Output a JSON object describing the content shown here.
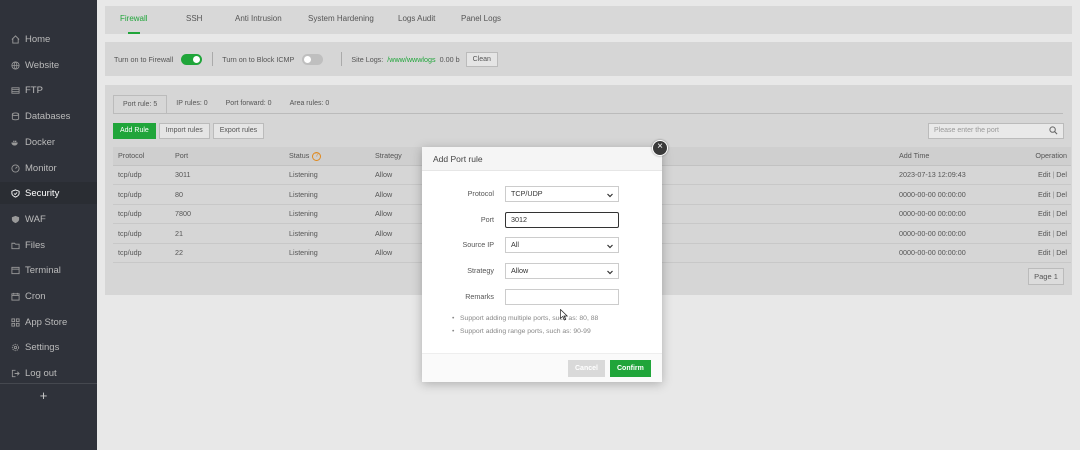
{
  "sidebar": {
    "items": [
      {
        "label": "Home",
        "icon": "home-icon"
      },
      {
        "label": "Website",
        "icon": "globe-icon"
      },
      {
        "label": "FTP",
        "icon": "ftp-icon"
      },
      {
        "label": "Databases",
        "icon": "database-icon"
      },
      {
        "label": "Docker",
        "icon": "docker-icon"
      },
      {
        "label": "Monitor",
        "icon": "monitor-icon"
      },
      {
        "label": "Security",
        "icon": "shield-icon"
      },
      {
        "label": "WAF",
        "icon": "waf-icon"
      },
      {
        "label": "Files",
        "icon": "folder-icon"
      },
      {
        "label": "Terminal",
        "icon": "terminal-icon"
      },
      {
        "label": "Cron",
        "icon": "cron-icon"
      },
      {
        "label": "App Store",
        "icon": "apps-icon"
      },
      {
        "label": "Settings",
        "icon": "gear-icon"
      },
      {
        "label": "Log out",
        "icon": "logout-icon"
      }
    ],
    "add_label": "+"
  },
  "tabs": [
    "Firewall",
    "SSH",
    "Anti Intrusion",
    "System Hardening",
    "Logs Audit",
    "Panel Logs"
  ],
  "toolbar": {
    "firewall_label": "Turn on to Firewall",
    "icmp_label": "Turn on to Block ICMP",
    "site_logs_label": "Site Logs:",
    "site_logs_path": "/www/wwwlogs",
    "site_logs_size": "0.00 b",
    "clean_label": "Clean"
  },
  "subtabs": [
    "Port rule: 5",
    "IP rules: 0",
    "Port forward: 0",
    "Area rules: 0"
  ],
  "actions": {
    "add_rule": "Add Rule",
    "import_rules": "Import rules",
    "export_rules": "Export rules",
    "search_placeholder": "Please enter the port"
  },
  "table": {
    "headers": {
      "protocol": "Protocol",
      "port": "Port",
      "status": "Status",
      "strategy": "Strategy",
      "add_time": "Add Time",
      "operation": "Operation"
    },
    "rows": [
      {
        "protocol": "tcp/udp",
        "port": "3011",
        "status": "Listening",
        "strategy": "Allow",
        "add_time": "2023-07-13 12:09:43",
        "edit": "Edit",
        "sep": "|",
        "del": "Del"
      },
      {
        "protocol": "tcp/udp",
        "port": "80",
        "status": "Listening",
        "strategy": "Allow",
        "add_time": "0000-00-00 00:00:00",
        "edit": "Edit",
        "sep": "|",
        "del": "Del"
      },
      {
        "protocol": "tcp/udp",
        "port": "7800",
        "status": "Listening",
        "strategy": "Allow",
        "add_time": "0000-00-00 00:00:00",
        "edit": "Edit",
        "sep": "|",
        "del": "Del"
      },
      {
        "protocol": "tcp/udp",
        "port": "21",
        "status": "Listening",
        "strategy": "Allow",
        "add_time": "0000-00-00 00:00:00",
        "edit": "Edit",
        "sep": "|",
        "del": "Del"
      },
      {
        "protocol": "tcp/udp",
        "port": "22",
        "status": "Listening",
        "strategy": "Allow",
        "add_time": "0000-00-00 00:00:00",
        "edit": "Edit",
        "sep": "|",
        "del": "Del"
      }
    ],
    "pager": "Page 1"
  },
  "dialog": {
    "title": "Add Port rule",
    "close": "×",
    "protocol_label": "Protocol",
    "protocol_value": "TCP/UDP",
    "port_label": "Port",
    "port_value": "3012",
    "source_ip_label": "Source IP",
    "source_ip_value": "All",
    "strategy_label": "Strategy",
    "strategy_value": "Allow",
    "remarks_label": "Remarks",
    "remarks_value": "",
    "tips": [
      "Support adding multiple ports, such as: 80, 88",
      "Support adding range ports, such as: 90-99"
    ],
    "cancel": "Cancel",
    "confirm": "Confirm"
  },
  "colors": {
    "accent": "#20a53a",
    "sidebar_bg": "#2f323a",
    "warning": "#e0891e"
  }
}
